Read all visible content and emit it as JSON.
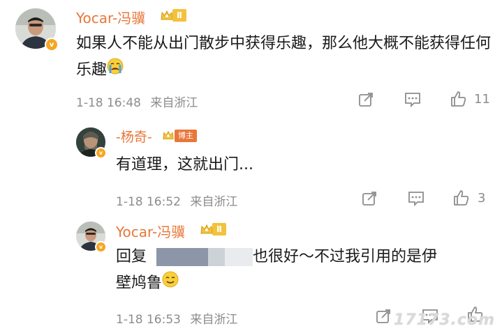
{
  "comments": [
    {
      "author": "Yocar-冯骥",
      "rank_level": "Ⅱ",
      "text": "如果人不能从出门散步中获得乐趣，那么他大概不能获得任何乐趣",
      "date": "1-18 16:48",
      "location": "来自浙江",
      "like_count": "11"
    },
    {
      "author": "-杨奇-",
      "tag": "博主",
      "text": "有道理，这就出门...",
      "date": "1-18 16:52",
      "location": "来自浙江",
      "like_count": "3"
    },
    {
      "author": "Yocar-冯骥",
      "rank_level": "Ⅱ",
      "reply_prefix": "回复",
      "reply_text": "也很好～不过我引用的是伊",
      "reply_text2": "壁鸠鲁",
      "date": "1-18 16:53",
      "location": "来自浙江"
    }
  ],
  "watermark": "17173.com",
  "colors": {
    "username": "#e8773a",
    "meta": "#8c8c8c",
    "badge": "#f3c23d"
  }
}
